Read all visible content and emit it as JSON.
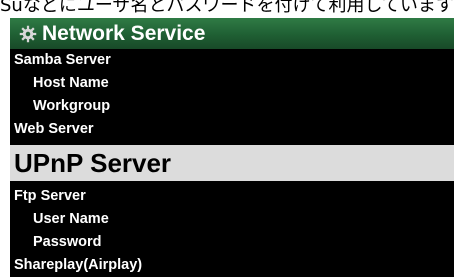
{
  "top_text": "Suなどにユーザ名とパスワードを付けて利用しています",
  "header": {
    "title": "Network Service",
    "icon": "gear-icon"
  },
  "menu": [
    {
      "label": "Samba Server",
      "level": 0
    },
    {
      "label": "Host Name",
      "level": 1
    },
    {
      "label": "Workgroup",
      "level": 1
    },
    {
      "label": "Web Server",
      "level": 0
    },
    {
      "label": "UPnP Server",
      "level": 0,
      "selected": true
    },
    {
      "label": "Ftp Server",
      "level": 0
    },
    {
      "label": "User Name",
      "level": 1
    },
    {
      "label": "Password",
      "level": 1
    },
    {
      "label": "Shareplay(Airplay)",
      "level": 0
    }
  ],
  "colors": {
    "header_bg": "#1f5f33",
    "selected_bg": "#dcdcdc",
    "screen_bg": "#000000"
  }
}
